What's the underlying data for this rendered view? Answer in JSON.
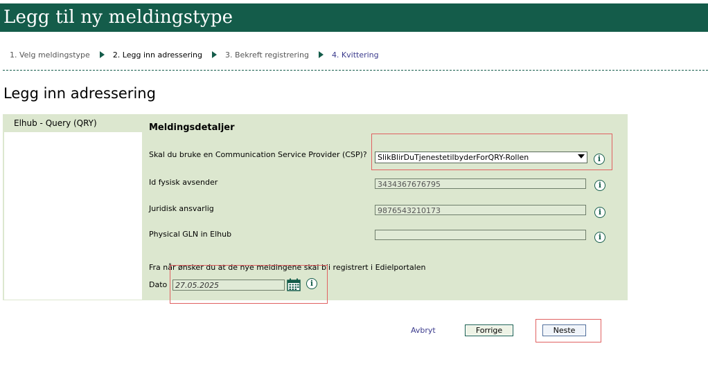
{
  "header": {
    "title": "Legg til ny meldingstype"
  },
  "steps": [
    {
      "label": "1. Velg meldingstype"
    },
    {
      "label": "2. Legg inn adressering"
    },
    {
      "label": "3. Bekreft registrering"
    },
    {
      "label": "4. Kvittering"
    }
  ],
  "page": {
    "title": "Legg inn adressering"
  },
  "left": {
    "item": "Elhub - Query (QRY)"
  },
  "section": {
    "title": "Meldingsdetaljer"
  },
  "fields": {
    "csp": {
      "label": "Skal du bruke en Communication Service Provider (CSP)?",
      "value": "SlikBlirDuTjenestetilbyderForQRY-Rollen"
    },
    "id_fysisk": {
      "label": "Id fysisk avsender",
      "value": "3434367676795"
    },
    "juridisk": {
      "label": "Juridisk ansvarlig",
      "value": "9876543210173"
    },
    "physical_gln": {
      "label": "Physical GLN in Elhub",
      "value": ""
    },
    "date_question": "Fra når ønsker du at de nye meldingene skal bli registrert i Edielportalen",
    "dato": {
      "label": "Dato",
      "value": "27.05.2025"
    }
  },
  "actions": {
    "cancel": "Avbryt",
    "previous": "Forrige",
    "next": "Neste"
  },
  "icons": {
    "info": "info-icon",
    "calendar": "calendar-icon",
    "step_arrow": "chevron-right-icon",
    "dropdown": "chevron-down-icon"
  },
  "colors": {
    "brand": "#145c4a",
    "panel": "#dce7cf",
    "highlight": "#e06060"
  }
}
